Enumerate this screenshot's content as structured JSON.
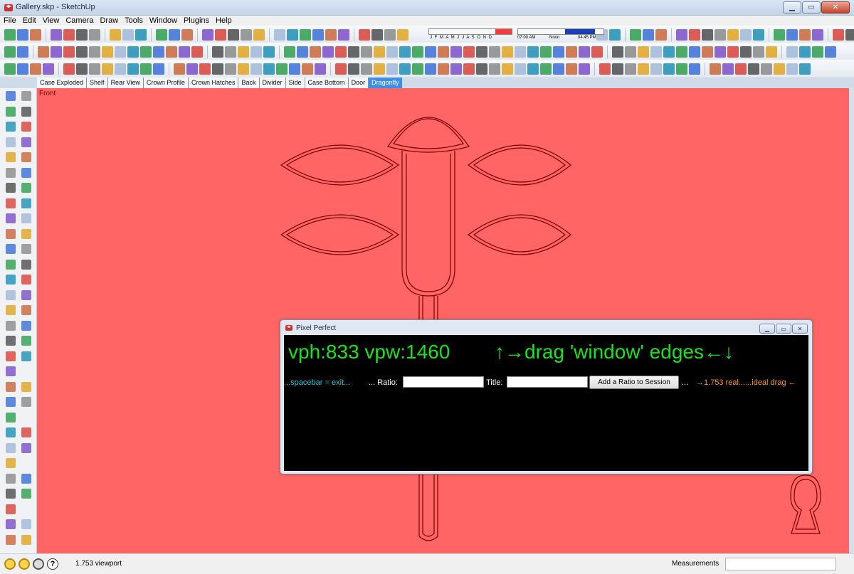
{
  "window": {
    "title": "Gallery.skp - SketchUp"
  },
  "menu": [
    "File",
    "Edit",
    "View",
    "Camera",
    "Draw",
    "Tools",
    "Window",
    "Plugins",
    "Help"
  ],
  "toolbar": {
    "shadow_months": "J F M A M J J A S O N D",
    "time_start": "07:00 AM",
    "time_noon": "Noon",
    "time_end": "04:45 PM"
  },
  "scene_tabs": [
    "Case Exploded",
    "Shelf",
    "Rear View",
    "Crown Profile",
    "Crown Hatches",
    "Back",
    "Divider",
    "Side",
    "Case Bottom",
    "Door",
    "Dragonfly"
  ],
  "active_scene_tab": "Dragonfly",
  "viewport": {
    "view_label": "Front",
    "background_color": "#ff6565",
    "outline_color": "#7a0000"
  },
  "pixel_perfect": {
    "title": "Pixel Perfect",
    "dims": "vph:833 vpw:1460",
    "drag_hint": "↑→drag 'window' edges←↓",
    "spacebar_hint": "...spacebar = exit...",
    "ratio_label": "... Ratio:",
    "ratio_value": "",
    "title_label": "Title:",
    "title_value": "",
    "add_button": "Add a Ratio to Session",
    "dots": "...",
    "real_ideal": "→1.753 real......ideal drag ←",
    "colors": {
      "big": "#19e319",
      "hint": "#22c9d8",
      "real": "#ff9a00"
    }
  },
  "status": {
    "text": "1.753  viewport",
    "measurements_label": "Measurements",
    "measurements_value": ""
  }
}
